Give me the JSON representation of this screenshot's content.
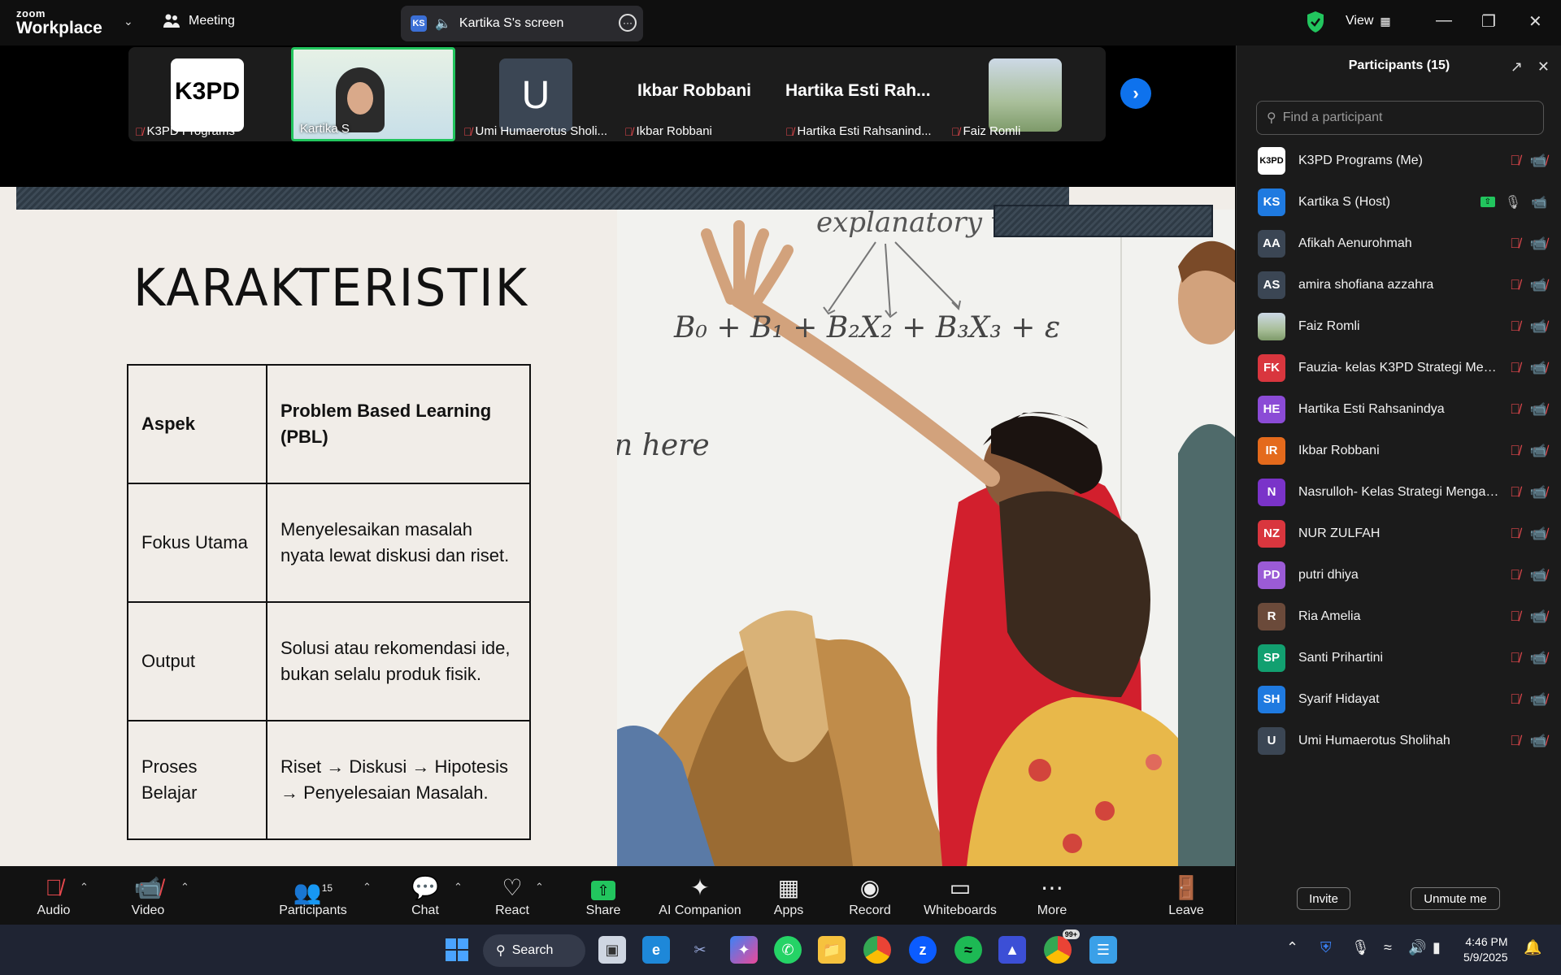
{
  "app": {
    "logo_small": "zoom",
    "logo_big": "Workplace",
    "meeting_label": "Meeting",
    "screen_share_label": "Kartika S's screen",
    "screen_share_badge": "KS",
    "view_label": "View"
  },
  "strip": {
    "tiles": [
      {
        "name": "K3PD Programs"
      },
      {
        "name": "Kartika S"
      },
      {
        "name": "Umi Humaerotus Sholi...",
        "initial": "U"
      },
      {
        "name": "Ikbar Robbani",
        "display": "Ikbar Robbani"
      },
      {
        "name": "Hartika Esti Rahsanind...",
        "display": "Hartika  Esti  Rah..."
      },
      {
        "name": "Faiz Romli"
      }
    ],
    "k3pd_logo_text": "K3PD"
  },
  "slide": {
    "title": "KARAKTERISTIK",
    "table": [
      [
        "Aspek",
        "Problem Based Learning (PBL)"
      ],
      [
        "Fokus Utama",
        "Menyelesaikan masalah nyata lewat diskusi dan riset."
      ],
      [
        "Output",
        "Solusi atau rekomendasi ide, bukan selalu produk fisik."
      ],
      [
        "Proses Belajar",
        "Riset → Diskusi → Hipotesis → Penyelesaian Masalah."
      ]
    ],
    "whiteboard_text_1": "explanatory v",
    "whiteboard_text_2": "n here",
    "whiteboard_formula": "B₀ + B₁    + B₂X₂ + B₃X₃ + ε"
  },
  "panel": {
    "title": "Participants (15)",
    "search_placeholder": "Find a participant",
    "participants": [
      {
        "name": "K3PD Programs (Me)",
        "avatar": "K3PD",
        "color": "#ffffff",
        "muted": true
      },
      {
        "name": "Kartika S (Host)",
        "avatar": "KS",
        "color": "#1f7ae0",
        "muted": false
      },
      {
        "name": "Afikah Aenurohmah",
        "avatar": "AA",
        "color": "#3b4654",
        "muted": true
      },
      {
        "name": "amira shofiana azzahra",
        "avatar": "AS",
        "color": "#3b4654",
        "muted": true
      },
      {
        "name": "Faiz Romli",
        "avatar": "",
        "color": "#8aa07a",
        "muted": true
      },
      {
        "name": "Fauzia- kelas K3PD Strategi Menga...",
        "avatar": "FK",
        "color": "#d9363e",
        "muted": true
      },
      {
        "name": "Hartika Esti Rahsanindya",
        "avatar": "HE",
        "color": "#8b4bd6",
        "muted": true
      },
      {
        "name": "Ikbar Robbani",
        "avatar": "IR",
        "color": "#e46a1c",
        "muted": true
      },
      {
        "name": "Nasrulloh- Kelas Strategi Mengaja...",
        "avatar": "N",
        "color": "#7a33c9",
        "muted": true
      },
      {
        "name": "NUR ZULFAH",
        "avatar": "NZ",
        "color": "#d9363e",
        "muted": true
      },
      {
        "name": "putri dhiya",
        "avatar": "PD",
        "color": "#9b5bd6",
        "muted": true
      },
      {
        "name": "Ria Amelia",
        "avatar": "R",
        "color": "#6b4a3a",
        "muted": true
      },
      {
        "name": "Santi Prihartini",
        "avatar": "SP",
        "color": "#12a070",
        "muted": true
      },
      {
        "name": "Syarif Hidayat",
        "avatar": "SH",
        "color": "#1f7ae0",
        "muted": true
      },
      {
        "name": "Umi Humaerotus Sholihah",
        "avatar": "U",
        "color": "#3b4654",
        "muted": true
      }
    ],
    "invite_label": "Invite",
    "unmute_label": "Unmute me"
  },
  "toolbar": {
    "audio": "Audio",
    "video": "Video",
    "participants": "Participants",
    "participants_count": "15",
    "chat": "Chat",
    "react": "React",
    "share": "Share",
    "ai_companion": "AI Companion",
    "apps": "Apps",
    "record": "Record",
    "whiteboards": "Whiteboards",
    "more": "More",
    "leave": "Leave"
  },
  "taskbar": {
    "search_label": "Search",
    "time": "4:46 PM",
    "date": "5/9/2025",
    "chrome_badge": "99+"
  },
  "colors": {
    "accent": "#0e72ed",
    "active_green": "#22c55e",
    "muted_red": "#e5484d"
  }
}
